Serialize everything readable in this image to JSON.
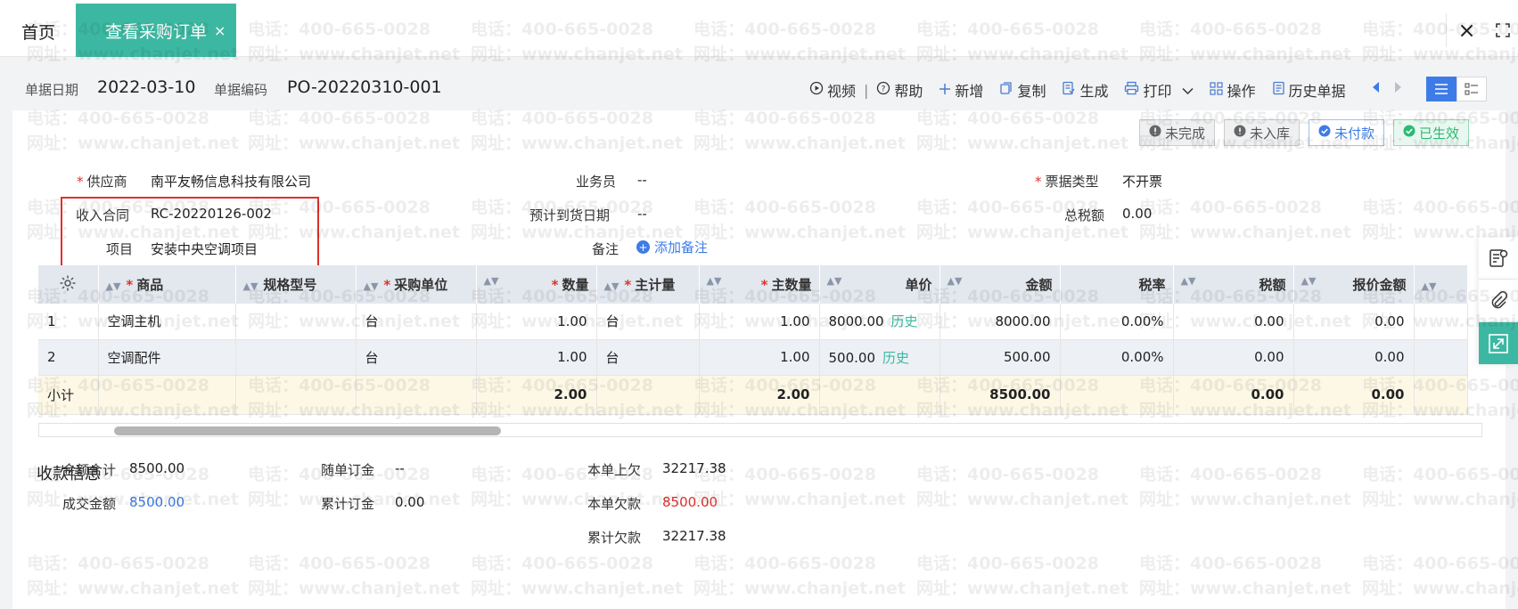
{
  "tabs": {
    "home": "首页",
    "active": "查看采购订单",
    "active_close": "×"
  },
  "window": {
    "close": "×"
  },
  "header": {
    "date_label": "单据日期",
    "date_value": "2022-03-10",
    "code_label": "单据编码",
    "code_value": "PO-20220310-001"
  },
  "toolbar": {
    "video": "视频",
    "sep": "|",
    "help": "帮助",
    "add": "新增",
    "copy": "复制",
    "generate": "生成",
    "print": "打印",
    "operate": "操作",
    "history": "历史单据"
  },
  "badges": {
    "incomplete": "未完成",
    "not_stocked": "未入库",
    "unpaid": "未付款",
    "effective": "已生效"
  },
  "form": {
    "supplier_label": "供应商",
    "supplier_value": "南平友畅信息科技有限公司",
    "salesman_label": "业务员",
    "salesman_value": "--",
    "ticket_type_label": "票据类型",
    "ticket_type_value": "不开票",
    "contract_label": "收入合同",
    "contract_value": "RC-20220126-002",
    "arrival_label": "预计到货日期",
    "arrival_value": "--",
    "tax_total_label": "总税额",
    "tax_total_value": "0.00",
    "project_label": "项目",
    "project_value": "安装中央空调项目",
    "remark_label": "备注",
    "remark_add": "添加备注",
    "required_mark": "*"
  },
  "table": {
    "headers": {
      "product": "商品",
      "spec": "规格型号",
      "unit": "采购单位",
      "qty": "数量",
      "main_unit": "主计量",
      "main_qty": "主数量",
      "price": "单价",
      "amount": "金额",
      "tax_rate": "税率",
      "tax": "税额",
      "quote_amount": "报价金额"
    },
    "history_label": "历史",
    "rows": [
      {
        "no": "1",
        "product": "空调主机",
        "spec": "",
        "unit": "台",
        "qty": "1.00",
        "main_unit": "台",
        "main_qty": "1.00",
        "price": "8000.00",
        "amount": "8000.00",
        "tax_rate": "0.00%",
        "tax": "0.00",
        "quote_amount": "0.00"
      },
      {
        "no": "2",
        "product": "空调配件",
        "spec": "",
        "unit": "台",
        "qty": "1.00",
        "main_unit": "台",
        "main_qty": "1.00",
        "price": "500.00",
        "amount": "500.00",
        "tax_rate": "0.00%",
        "tax": "0.00",
        "quote_amount": "0.00"
      }
    ],
    "subtotal": {
      "label": "小计",
      "qty": "2.00",
      "main_qty": "2.00",
      "amount": "8500.00",
      "tax": "0.00",
      "quote_amount": "0.00"
    }
  },
  "payment": {
    "title": "收款信息",
    "total_label": "金额合计",
    "total_value": "8500.00",
    "deal_label": "成交金额",
    "deal_value": "8500.00",
    "deposit_label": "随单订金",
    "deposit_value": "--",
    "acc_deposit_label": "累计订金",
    "acc_deposit_value": "0.00",
    "prev_owed_label": "本单上欠",
    "prev_owed_value": "32217.38",
    "owed_label": "本单欠款",
    "owed_value": "8500.00",
    "acc_owed_label": "累计欠款",
    "acc_owed_value": "32217.38"
  },
  "watermark": {
    "phone": "电话：400-665-0028",
    "site": "网址：www.chanjet.net"
  },
  "colors": {
    "accent": "#3cb8a2",
    "link": "#3d7ce6",
    "danger": "#e0302b",
    "success": "#2fb873"
  }
}
